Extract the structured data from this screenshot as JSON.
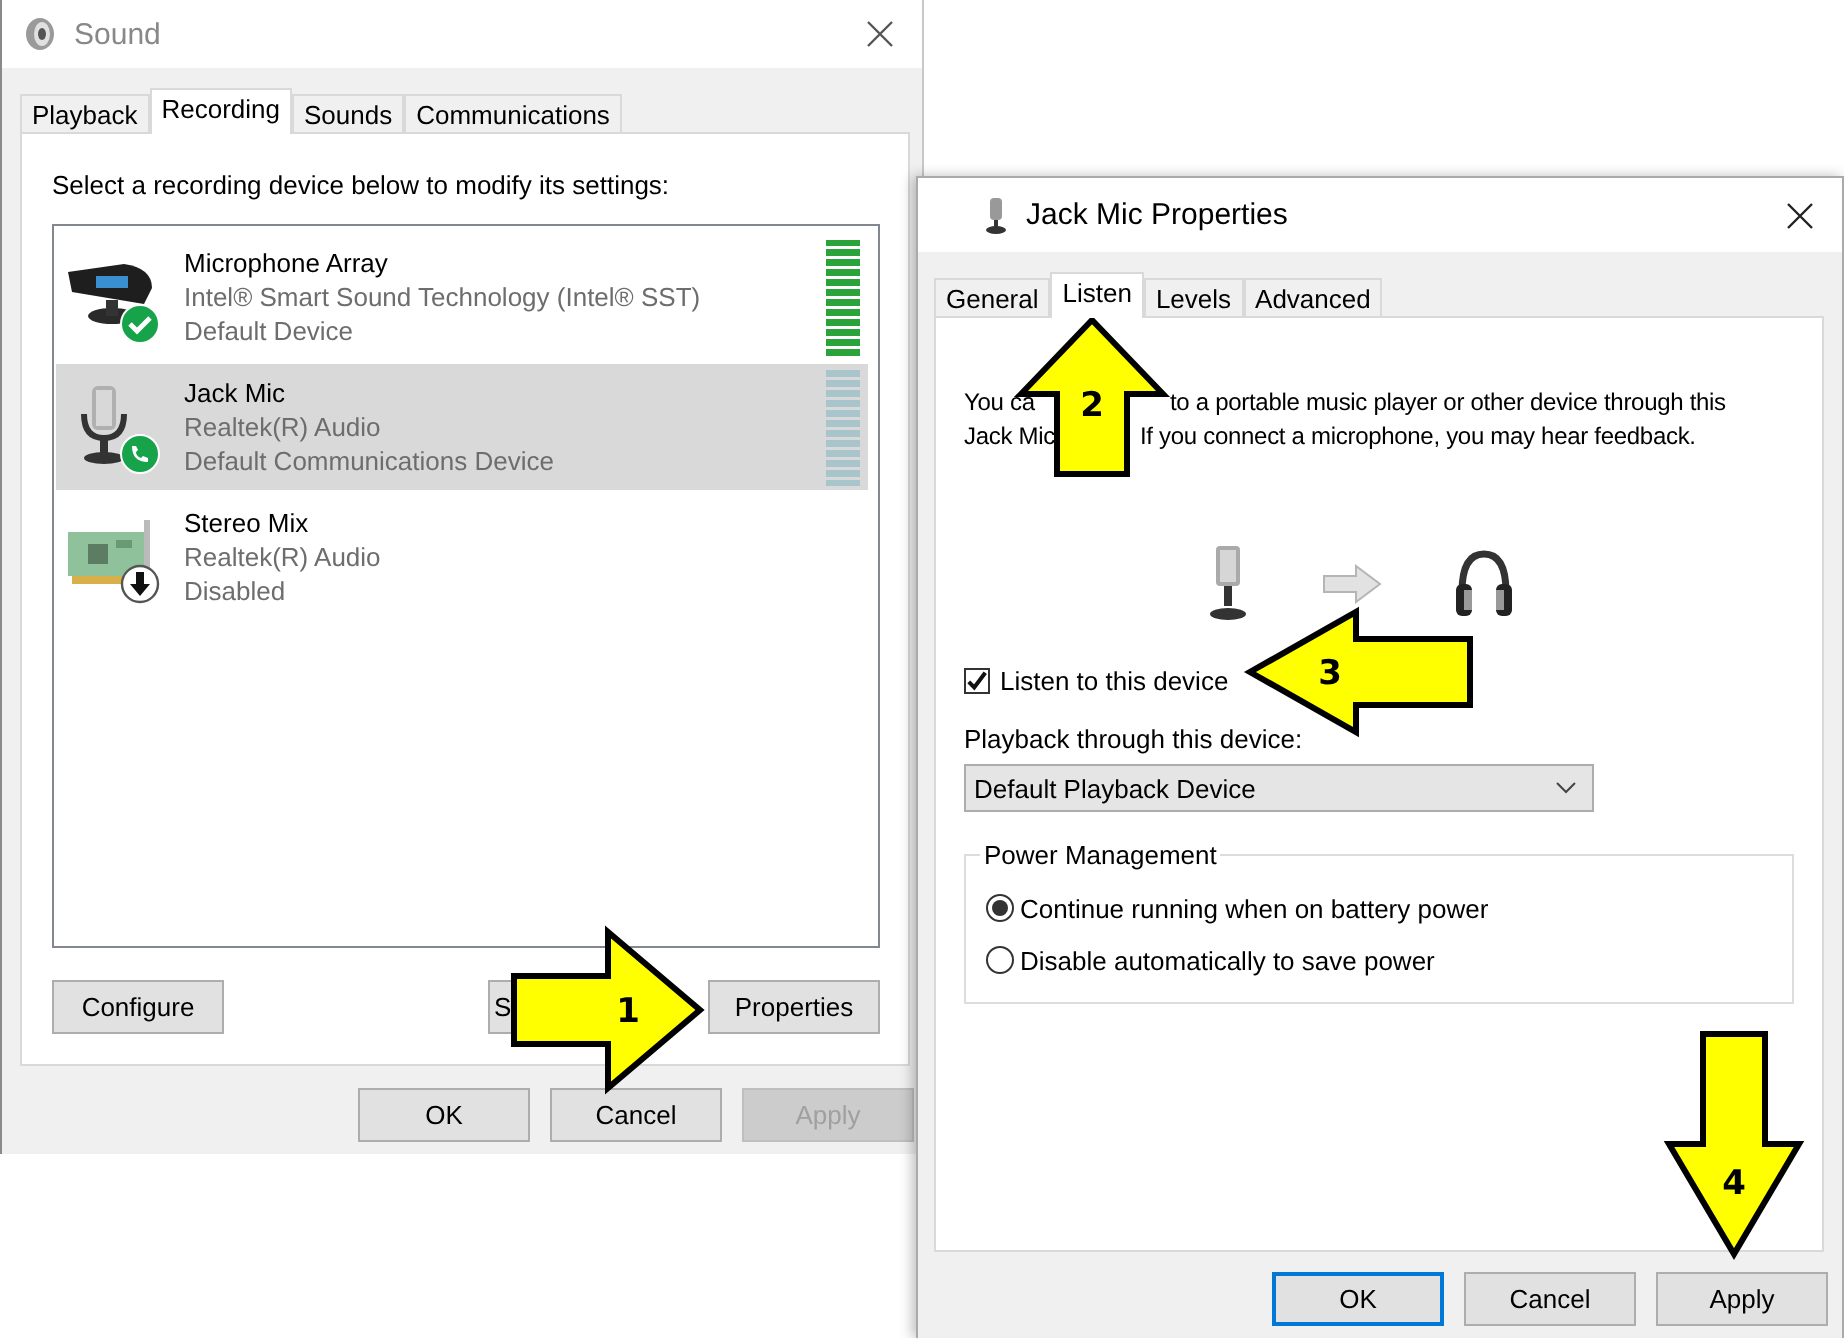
{
  "sound_window": {
    "title": "Sound",
    "tabs": [
      {
        "label": "Playback",
        "selected": false
      },
      {
        "label": "Recording",
        "selected": true
      },
      {
        "label": "Sounds",
        "selected": false
      },
      {
        "label": "Communications",
        "selected": false
      }
    ],
    "instruction": "Select a recording device below to modify its settings:",
    "devices": [
      {
        "name": "Microphone Array",
        "driver": "Intel® Smart Sound Technology (Intel® SST)",
        "status": "Default Device",
        "kind": "mic-array",
        "badge": {
          "kind": "check"
        },
        "selected": false,
        "level": 1
      },
      {
        "name": "Jack Mic",
        "driver": "Realtek(R) Audio",
        "status": "Default Communications Device",
        "kind": "jack-mic",
        "badge": {
          "kind": "phone"
        },
        "selected": true,
        "level": 0
      },
      {
        "name": "Stereo Mix",
        "driver": "Realtek(R) Audio",
        "status": "Disabled",
        "kind": "sound-card",
        "badge": {
          "kind": "down-arrow"
        },
        "selected": false
      }
    ],
    "actions": [
      {
        "label": "Configure"
      },
      {
        "label": "S"
      },
      {
        "label": "Properties"
      }
    ],
    "buttons": [
      {
        "label": "OK",
        "disabled": false
      },
      {
        "label": "Cancel",
        "disabled": false
      },
      {
        "label": "Apply",
        "disabled": true
      }
    ]
  },
  "properties_window": {
    "title": "Jack Mic Properties",
    "tabs": [
      {
        "label": "General",
        "selected": false
      },
      {
        "label": "Listen",
        "selected": true
      },
      {
        "label": "Levels",
        "selected": false
      },
      {
        "label": "Advanced",
        "selected": false
      }
    ],
    "description_lines": [
      {
        "parts": [
          "You ca",
          "to a portable music player or other device through this"
        ]
      },
      {
        "parts": [
          "Jack Mic",
          "If you connect a microphone, you may hear feedback."
        ]
      }
    ],
    "listen_checkbox": {
      "label": "Listen to this device",
      "checked": true
    },
    "playback_label": "Playback through this device:",
    "playback_select": {
      "value": "Default Playback Device"
    },
    "power_management": {
      "title": "Power Management",
      "options": [
        {
          "label": "Continue running when on battery power",
          "selected": true
        },
        {
          "label": "Disable automatically to save power",
          "selected": false
        }
      ]
    },
    "buttons": [
      {
        "label": "OK",
        "focused": true
      },
      {
        "label": "Cancel",
        "focused": false
      },
      {
        "label": "Apply",
        "focused": false
      }
    ]
  },
  "callouts": [
    {
      "number": "1",
      "kind": "right"
    },
    {
      "number": "2",
      "kind": "up"
    },
    {
      "number": "3",
      "kind": "left"
    },
    {
      "number": "4",
      "kind": "down"
    }
  ]
}
